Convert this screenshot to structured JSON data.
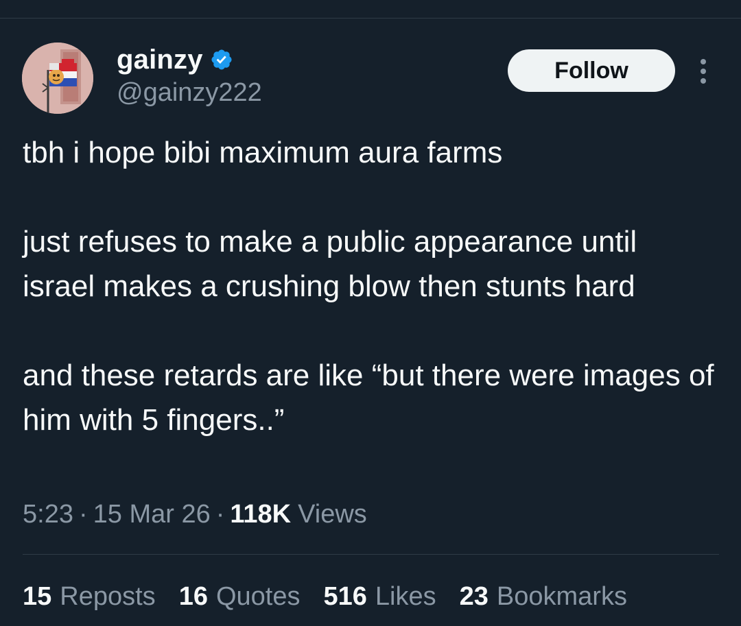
{
  "author": {
    "display_name": "gainzy",
    "handle": "@gainzy222",
    "verified": true,
    "avatar_icon": "avatar-image"
  },
  "actions": {
    "follow_label": "Follow",
    "more_icon": "more-options-icon"
  },
  "tweet": {
    "paragraphs": [
      "tbh i hope bibi maximum aura farms",
      "just refuses to make a public appearance until israel makes a crushing blow then stunts hard",
      "and these retards are like “but there were images of him with 5 fingers..”"
    ]
  },
  "meta": {
    "time": "5:23",
    "date": "15 Mar 26",
    "views_count": "118K",
    "views_label": "Views"
  },
  "stats": {
    "reposts_count": "15",
    "reposts_label": "Reposts",
    "quotes_count": "16",
    "quotes_label": "Quotes",
    "likes_count": "516",
    "likes_label": "Likes",
    "bookmarks_count": "23",
    "bookmarks_label": "Bookmarks"
  },
  "colors": {
    "background": "#15202b",
    "text_primary": "#f7f9f9",
    "text_secondary": "#8b98a5",
    "verified_blue": "#1d9bf0",
    "follow_button_bg": "#eff3f4",
    "divider": "#2f3b47"
  }
}
